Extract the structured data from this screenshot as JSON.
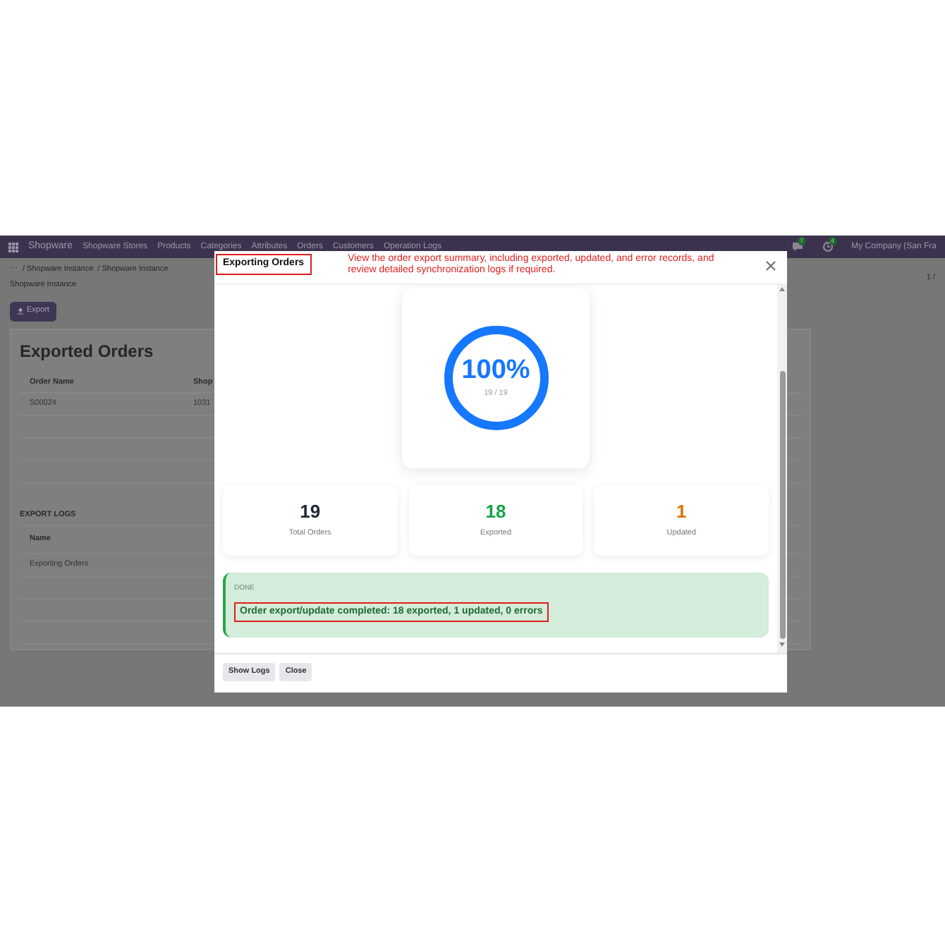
{
  "navbar": {
    "app": "Shopware",
    "menu": [
      "Shopware Stores",
      "Products",
      "Categories",
      "Attributes",
      "Orders",
      "Customers",
      "Operation Logs"
    ],
    "badges": [
      {
        "kind": "chat",
        "count": "7"
      },
      {
        "kind": "clock",
        "count": "4"
      }
    ],
    "company": "My Company (San Fra"
  },
  "breadcrumb": {
    "more": "⋯",
    "items": [
      "/ Shopware Instance",
      "/ Shopware Instance"
    ],
    "current": "Shopware Instance",
    "pager": "1 /"
  },
  "export_button": "Export",
  "card": {
    "title": "Exported Orders",
    "columns": [
      "Order Name",
      "Shop"
    ],
    "rows": [
      [
        "S00024",
        "1031"
      ]
    ],
    "logs_title": "EXPORT LOGS",
    "logs_columns": [
      "Name"
    ],
    "logs_rows": [
      "Exporting Orders"
    ]
  },
  "dialog": {
    "title": "Exporting Orders",
    "annotation": "View the order export summary, including exported, updated, and error records, and review detailed synchronization logs if required.",
    "progress": {
      "label": "100%",
      "count": "19 / 19",
      "level": 1
    },
    "stats": [
      {
        "value": "19",
        "label": "Total Orders",
        "color": "#1f2937"
      },
      {
        "value": "18",
        "label": "Exported",
        "color": "#16a34a"
      },
      {
        "value": "1",
        "label": "Updated",
        "color": "#d97706"
      }
    ],
    "status": {
      "label": "DONE",
      "message": "Order export/update completed: 18 exported, 1 updated, 0 errors"
    },
    "buttons": [
      "Show Logs",
      "Close"
    ]
  }
}
